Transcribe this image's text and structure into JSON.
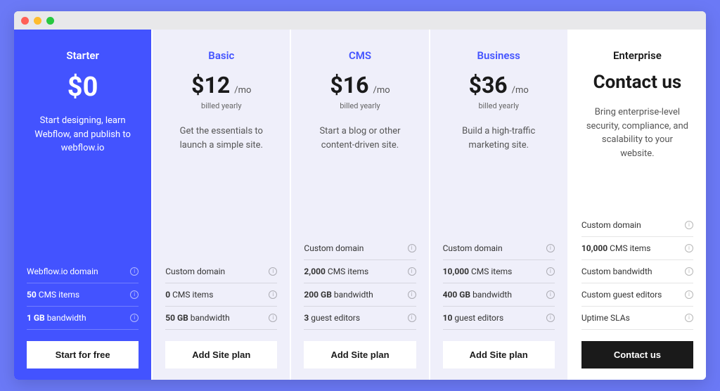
{
  "plans": [
    {
      "name": "Starter",
      "price": "$0",
      "per": "",
      "billing": "",
      "desc": "Start designing, learn Webflow, and publish to webflow.io",
      "features": [
        {
          "bold": "",
          "text": "Webflow.io domain"
        },
        {
          "bold": "50",
          "text": " CMS items"
        },
        {
          "bold": "1 GB",
          "text": " bandwidth"
        }
      ],
      "cta": "Start for free",
      "ctaStyle": "light"
    },
    {
      "name": "Basic",
      "price": "$12",
      "per": "/mo",
      "billing": "billed yearly",
      "desc": "Get the essentials to launch a simple site.",
      "features": [
        {
          "bold": "",
          "text": "Custom domain"
        },
        {
          "bold": "0",
          "text": " CMS items"
        },
        {
          "bold": "50 GB",
          "text": " bandwidth"
        }
      ],
      "cta": "Add Site plan",
      "ctaStyle": "light"
    },
    {
      "name": "CMS",
      "price": "$16",
      "per": "/mo",
      "billing": "billed yearly",
      "desc": "Start a blog or other content-driven site.",
      "features": [
        {
          "bold": "",
          "text": "Custom domain"
        },
        {
          "bold": "2,000",
          "text": " CMS items"
        },
        {
          "bold": "200 GB",
          "text": " bandwidth"
        },
        {
          "bold": "3",
          "text": " guest editors"
        }
      ],
      "cta": "Add Site plan",
      "ctaStyle": "light"
    },
    {
      "name": "Business",
      "price": "$36",
      "per": "/mo",
      "billing": "billed yearly",
      "desc": "Build a high-traffic marketing site.",
      "features": [
        {
          "bold": "",
          "text": "Custom domain"
        },
        {
          "bold": "10,000",
          "text": " CMS items"
        },
        {
          "bold": "400 GB",
          "text": " bandwidth"
        },
        {
          "bold": "10",
          "text": " guest editors"
        }
      ],
      "cta": "Add Site plan",
      "ctaStyle": "light"
    },
    {
      "name": "Enterprise",
      "price": "",
      "per": "",
      "billing": "",
      "contactLabel": "Contact us",
      "desc": "Bring enterprise-level security, compliance, and scalability to your website.",
      "features": [
        {
          "bold": "",
          "text": "Custom domain"
        },
        {
          "bold": "10,000",
          "text": " CMS items"
        },
        {
          "bold": "",
          "text": "Custom bandwidth"
        },
        {
          "bold": "",
          "text": "Custom guest editors"
        },
        {
          "bold": "",
          "text": "Uptime SLAs"
        }
      ],
      "cta": "Contact us",
      "ctaStyle": "dark"
    }
  ]
}
